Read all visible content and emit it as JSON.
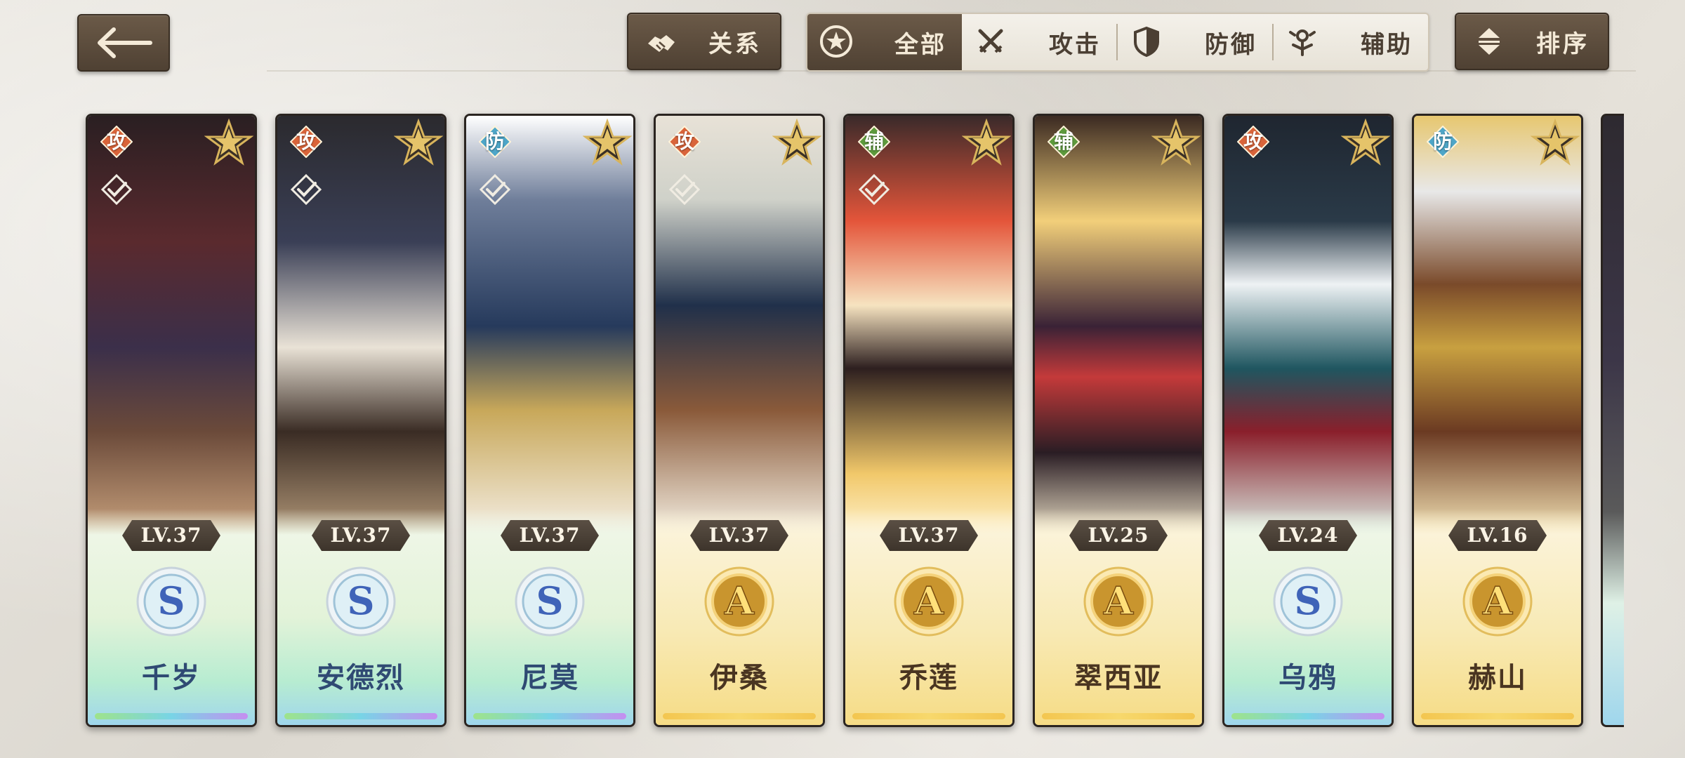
{
  "topbar": {
    "back_label": "",
    "relation_label": "关系",
    "tabs": [
      {
        "label": "全部",
        "icon": "star-circle-icon",
        "active": true
      },
      {
        "label": "攻击",
        "icon": "crossed-swords-icon",
        "active": false
      },
      {
        "label": "防御",
        "icon": "shield-icon",
        "active": false
      },
      {
        "label": "辅助",
        "icon": "support-icon",
        "active": false
      }
    ],
    "sort_label": "排序"
  },
  "colors": {
    "attack": "#d9643a",
    "defense": "#4ea6c8",
    "support": "#5d9a3c",
    "button_brown": "#5b4b3c",
    "name_blue": "#2f4a73",
    "name_brown": "#4a3521"
  },
  "characters": [
    {
      "name": "千岁",
      "role": "攻",
      "role_type": "attack",
      "level": "LV.37",
      "rank": "S",
      "checked": true
    },
    {
      "name": "安德烈",
      "role": "攻",
      "role_type": "attack",
      "level": "LV.37",
      "rank": "S",
      "checked": true
    },
    {
      "name": "尼莫",
      "role": "防",
      "role_type": "defense",
      "level": "LV.37",
      "rank": "S",
      "checked": true
    },
    {
      "name": "伊桑",
      "role": "攻",
      "role_type": "attack",
      "level": "LV.37",
      "rank": "A",
      "checked": true
    },
    {
      "name": "乔莲",
      "role": "辅",
      "role_type": "support",
      "level": "LV.37",
      "rank": "A",
      "checked": true
    },
    {
      "name": "翠西亚",
      "role": "辅",
      "role_type": "support",
      "level": "LV.25",
      "rank": "A",
      "checked": false
    },
    {
      "name": "乌鸦",
      "role": "攻",
      "role_type": "attack",
      "level": "LV.24",
      "rank": "S",
      "checked": false
    },
    {
      "name": "赫山",
      "role": "防",
      "role_type": "defense",
      "level": "LV.16",
      "rank": "A",
      "checked": false
    }
  ]
}
